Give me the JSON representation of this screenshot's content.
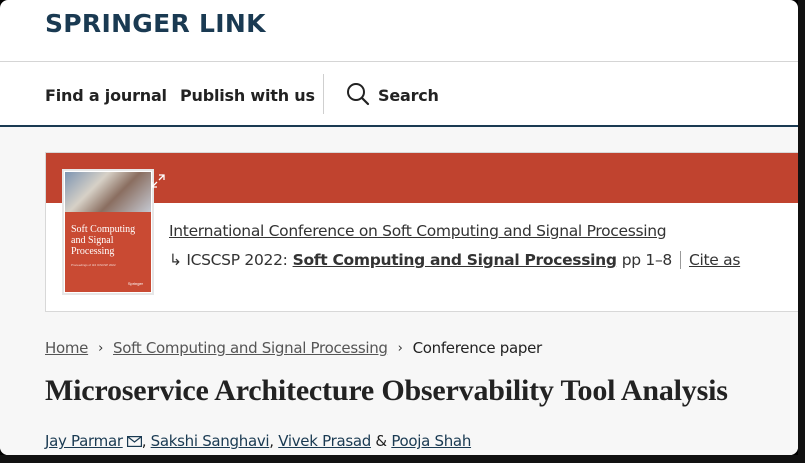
{
  "header": {
    "logo": "SPRINGER LINK",
    "nav": {
      "find_journal": "Find a journal",
      "publish": "Publish with us",
      "search": "Search"
    }
  },
  "book": {
    "cover": {
      "title": "Soft Computing and Signal Processing",
      "subtitle": "Proceedings of 3rd ICSCSP 2022",
      "publisher": "Springer"
    },
    "conference": "International Conference on Soft Computing and Signal Processing",
    "series_prefix": "ICSCSP 2022:",
    "book_title": "Soft Computing and Signal Processing",
    "pages": "pp 1–8",
    "cite": "Cite as"
  },
  "breadcrumb": {
    "home": "Home",
    "parent": "Soft Computing and Signal Processing",
    "current": "Conference paper"
  },
  "paper": {
    "title": "Microservice Architecture Observability Tool Analysis",
    "authors": [
      "Jay Parmar",
      "Sakshi Sanghavi",
      "Vivek Prasad",
      "Pooja Shah"
    ]
  },
  "colors": {
    "brand": "#1a3a52",
    "band": "#c0432f"
  }
}
